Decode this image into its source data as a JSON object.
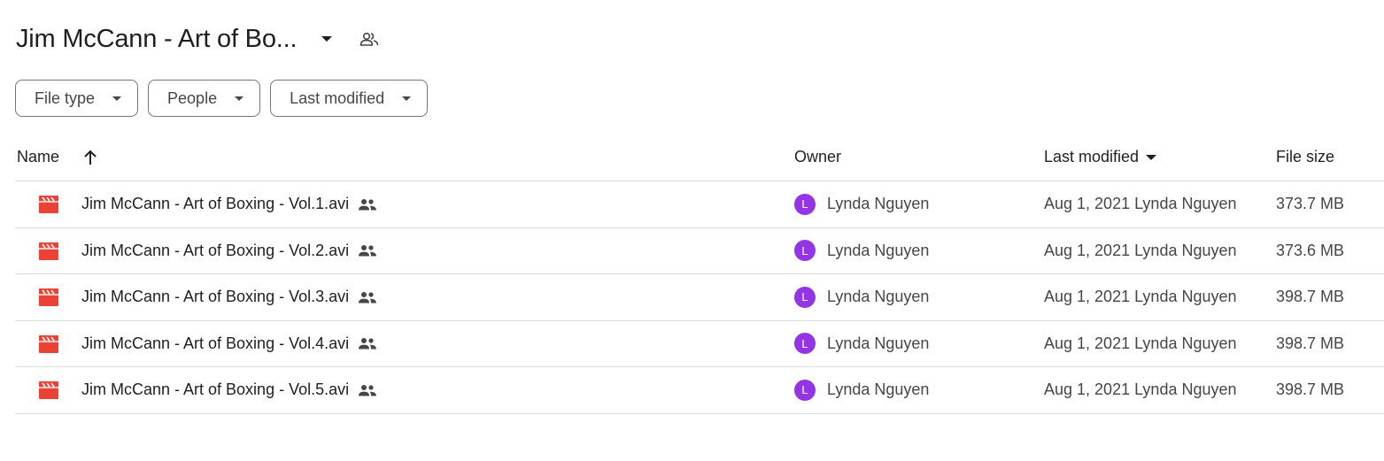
{
  "folder": {
    "title": "Jim McCann - Art of Bo...",
    "caret_icon": "arrow-drop-down-icon",
    "shared_icon": "people-outline-icon"
  },
  "filters": [
    {
      "label": "File type"
    },
    {
      "label": "People"
    },
    {
      "label": "Last modified"
    }
  ],
  "columns": {
    "name": "Name",
    "owner": "Owner",
    "last_modified": "Last modified",
    "file_size": "File size"
  },
  "files": [
    {
      "name": "Jim McCann - Art of Boxing - Vol.1.avi",
      "owner": "Lynda Nguyen",
      "owner_initial": "L",
      "modified": "Aug 1, 2021 Lynda Nguyen",
      "size": "373.7 MB"
    },
    {
      "name": "Jim McCann - Art of Boxing - Vol.2.avi",
      "owner": "Lynda Nguyen",
      "owner_initial": "L",
      "modified": "Aug 1, 2021 Lynda Nguyen",
      "size": "373.6 MB"
    },
    {
      "name": "Jim McCann - Art of Boxing - Vol.3.avi",
      "owner": "Lynda Nguyen",
      "owner_initial": "L",
      "modified": "Aug 1, 2021 Lynda Nguyen",
      "size": "398.7 MB"
    },
    {
      "name": "Jim McCann - Art of Boxing - Vol.4.avi",
      "owner": "Lynda Nguyen",
      "owner_initial": "L",
      "modified": "Aug 1, 2021 Lynda Nguyen",
      "size": "398.7 MB"
    },
    {
      "name": "Jim McCann - Art of Boxing - Vol.5.avi",
      "owner": "Lynda Nguyen",
      "owner_initial": "L",
      "modified": "Aug 1, 2021 Lynda Nguyen",
      "size": "398.7 MB"
    }
  ],
  "colors": {
    "video_icon": "#ea4335",
    "avatar": "#9334e6",
    "divider": "#dadce0",
    "text": "#1f1f1f"
  }
}
